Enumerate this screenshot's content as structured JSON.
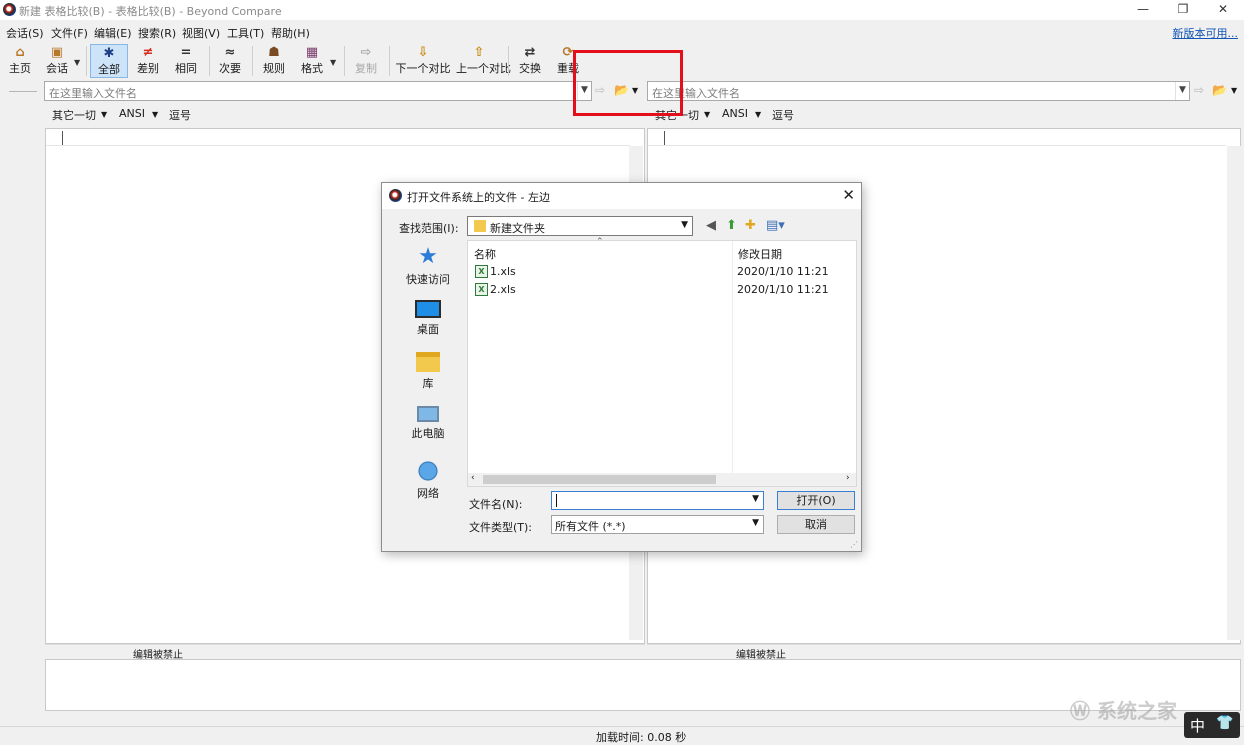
{
  "window": {
    "title": "新建 表格比较(B) - 表格比较(B) - Beyond Compare",
    "minimize": "—",
    "restore": "❐",
    "close": "✕"
  },
  "menu": {
    "items": [
      "会话(S)",
      "文件(F)",
      "编辑(E)",
      "搜索(R)",
      "视图(V)",
      "工具(T)",
      "帮助(H)"
    ],
    "update_link": "新版本可用..."
  },
  "toolbar": {
    "home": "主页",
    "session": "会话",
    "all": "全部",
    "diffs": "差别",
    "same": "相同",
    "minor": "次要",
    "rules": "规则",
    "format": "格式",
    "copy": "复制",
    "next_diff": "下一个对比",
    "prev_diff": "上一个对比",
    "swap": "交换",
    "reload": "重载",
    "icons": {
      "home": "⌂",
      "session": "▣",
      "all": "✱",
      "diffs": "≠",
      "same": "=",
      "minor": "≈",
      "rules": "☗",
      "format": "▦",
      "copy": "⇨",
      "next": "⇩",
      "prev": "⇧",
      "swap": "⇄",
      "reload": "⟳",
      "dropdown": "▼"
    }
  },
  "left": {
    "path_placeholder": "在这里输入文件名",
    "format": [
      "其它一切",
      "ANSI",
      "逗号"
    ],
    "status": "编辑被禁止"
  },
  "right": {
    "path_placeholder": "在这里输入文件名",
    "format": [
      "其它一切",
      "ANSI",
      "逗号"
    ],
    "status": "编辑被禁止"
  },
  "statusbar": {
    "load_time": "加载时间: 0.08 秒"
  },
  "dialog": {
    "title": "打开文件系统上的文件 - 左边",
    "close": "✕",
    "look_in_label": "查找范围(I):",
    "look_in_value": "新建文件夹",
    "places": [
      "快速访问",
      "桌面",
      "库",
      "此电脑",
      "网络"
    ],
    "columns": {
      "name": "名称",
      "modified": "修改日期"
    },
    "files": [
      {
        "name": "1.xls",
        "modified": "2020/1/10 11:21"
      },
      {
        "name": "2.xls",
        "modified": "2020/1/10 11:21"
      }
    ],
    "filename_label": "文件名(N):",
    "filename_value": "",
    "filetype_label": "文件类型(T):",
    "filetype_value": "所有文件 (*.*)",
    "open_button": "打开(O)",
    "cancel_button": "取消"
  },
  "ime": {
    "mode": "中",
    "tray": "👕"
  },
  "colors": {
    "highlight": "#e3101b",
    "active_button": "#cde3f7",
    "link": "#1356b5"
  }
}
